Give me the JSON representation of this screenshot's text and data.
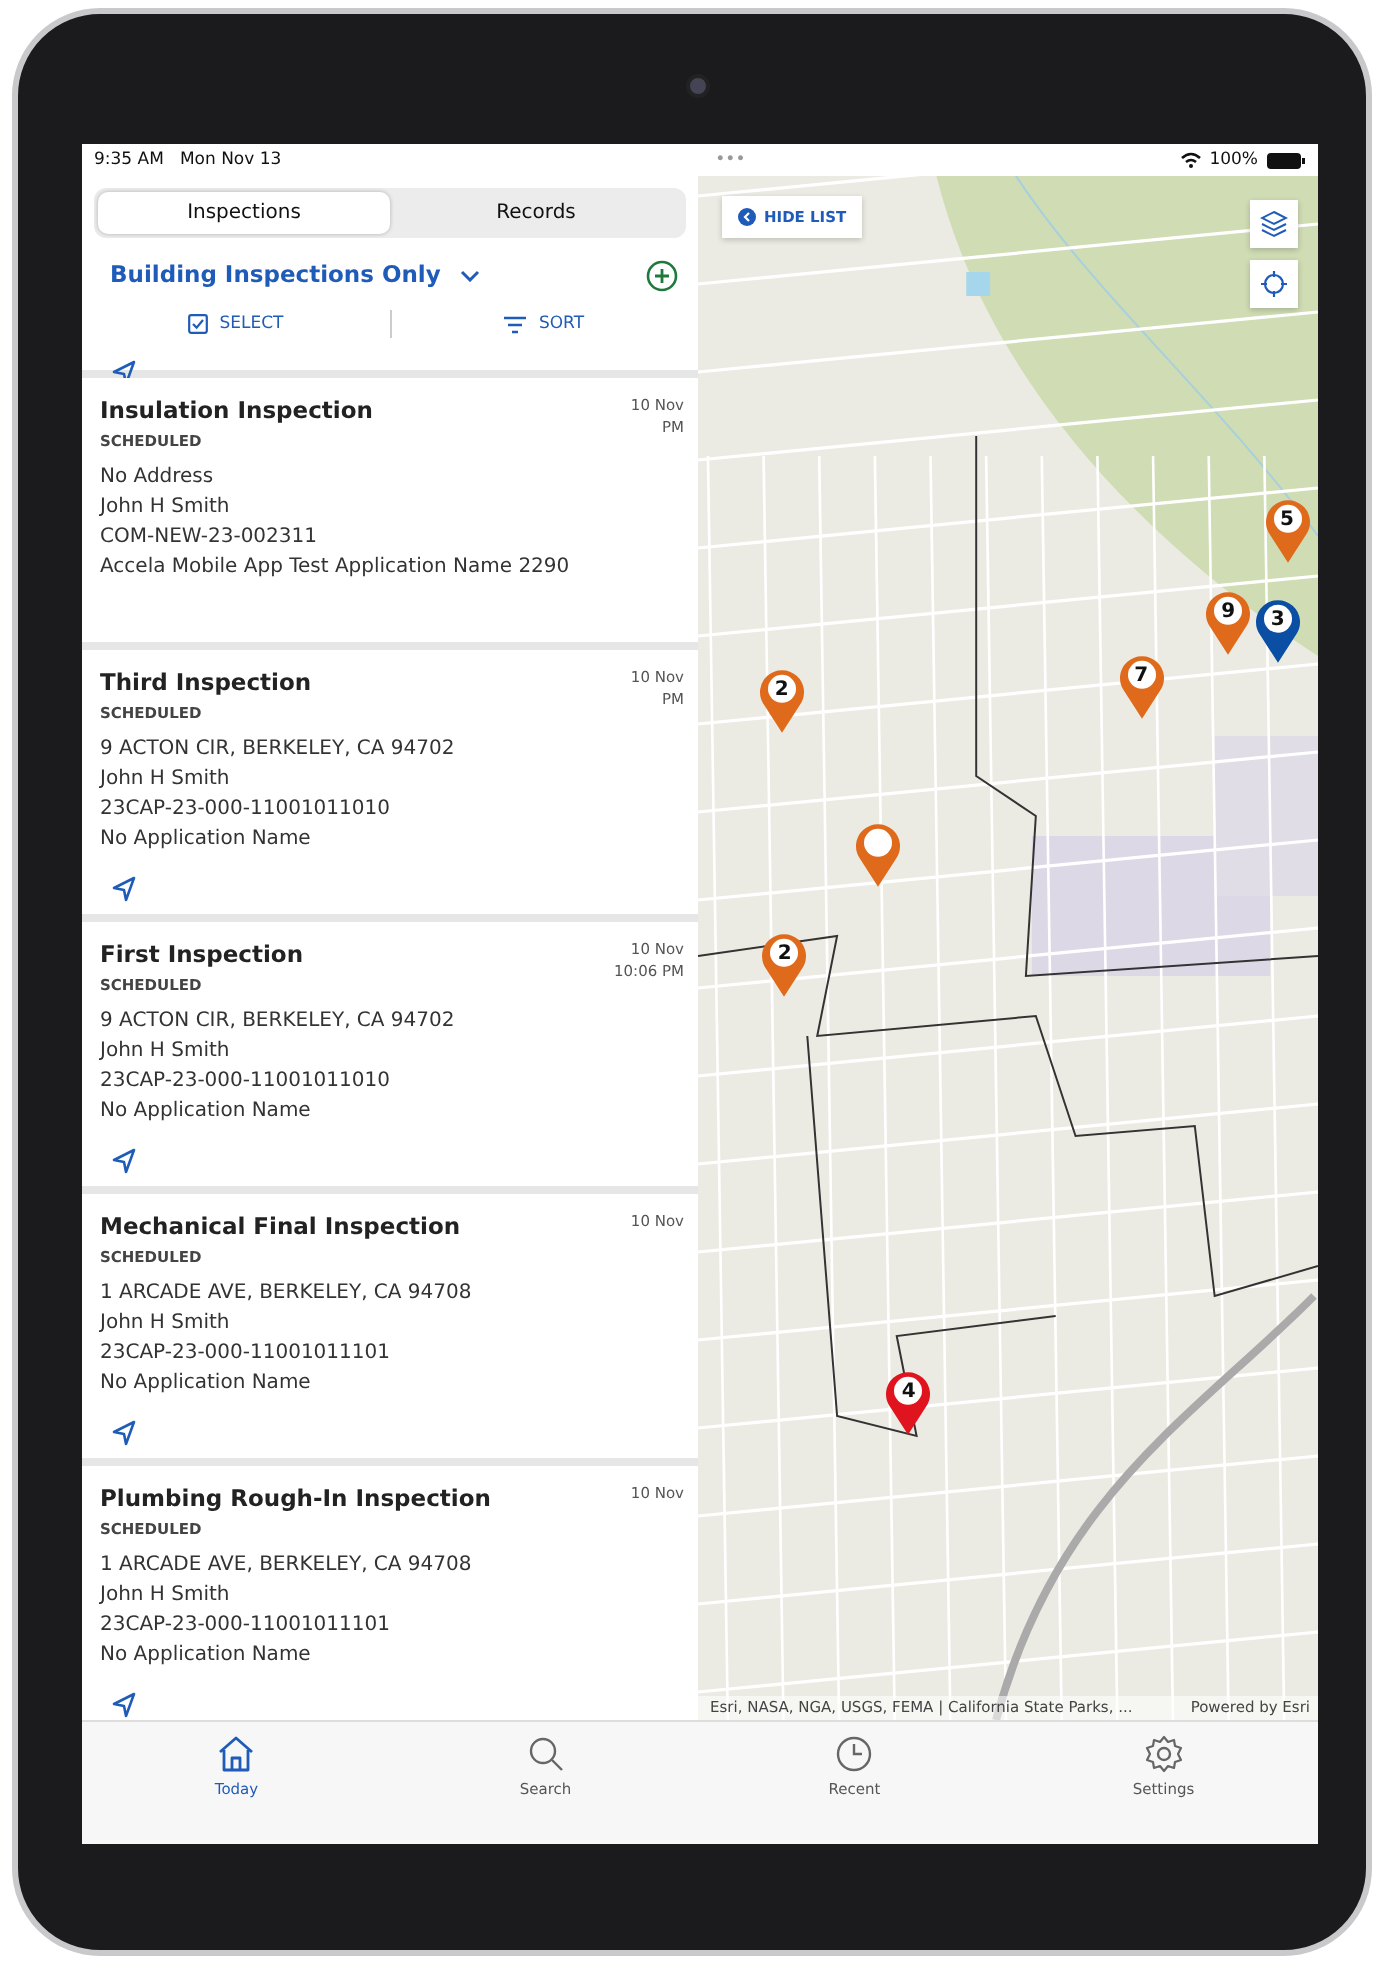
{
  "status_bar": {
    "time": "9:35 AM",
    "date": "Mon Nov 13",
    "dots": "•••",
    "battery": "100%"
  },
  "tabs": [
    {
      "label": "Inspections",
      "selected": true
    },
    {
      "label": "Records",
      "selected": false
    }
  ],
  "filter": {
    "label": "Building Inspections Only"
  },
  "actions": [
    {
      "kind": "select",
      "label": "SELECT"
    },
    {
      "kind": "sort",
      "label": "SORT"
    }
  ],
  "inspections": [
    {
      "navigate": true
    },
    {
      "title": "Insulation Inspection",
      "status": "SCHEDULED",
      "date": "10 Nov",
      "time": "PM",
      "lines": [
        "No Address",
        "John H Smith",
        "COM-NEW-23-002311",
        "Accela Mobile App Test Application Name 2290"
      ],
      "navigate": false
    },
    {
      "title": "Third Inspection",
      "status": "SCHEDULED",
      "date": "10 Nov",
      "time": "PM",
      "lines": [
        "9 ACTON CIR, BERKELEY, CA 94702",
        "John H Smith",
        "23CAP-23-000-11001011010",
        "No Application Name"
      ],
      "navigate": true
    },
    {
      "title": "First Inspection",
      "status": "SCHEDULED",
      "date": "10 Nov",
      "time": "10:06 PM",
      "lines": [
        "9 ACTON CIR, BERKELEY, CA 94702",
        "John H Smith",
        "23CAP-23-000-11001011010",
        "No Application Name"
      ],
      "navigate": true
    },
    {
      "title": "Mechanical Final Inspection",
      "status": "SCHEDULED",
      "date": "10 Nov",
      "lines": [
        "1 ARCADE AVE, BERKELEY, CA 94708",
        "John H Smith",
        "23CAP-23-000-11001011101",
        "No Application Name"
      ],
      "navigate": true
    },
    {
      "title": "Plumbing Rough-In Inspection",
      "status": "SCHEDULED",
      "date": "10 Nov",
      "lines": [
        "1 ARCADE AVE, BERKELEY, CA 94708",
        "John H Smith",
        "23CAP-23-000-11001011101",
        "No Application Name"
      ],
      "navigate": true
    }
  ],
  "map": {
    "hide_list": "HIDE LIST",
    "attribution": "Esri, NASA, NGA, USGS, FEMA | California State Parks, ...",
    "powered_by": "Powered by Esri",
    "pins": [
      {
        "label": "2",
        "color": "#e06a1b"
      },
      {
        "color": "#e06a1b"
      },
      {
        "label": "2",
        "color": "#e06a1b"
      },
      {
        "label": "7",
        "color": "#e06a1b"
      },
      {
        "label": "5",
        "color": "#e06a1b"
      },
      {
        "label": "9",
        "color": "#e06a1b"
      },
      {
        "label": "3",
        "color": "#0a4fa3"
      },
      {
        "label": "4",
        "color": "#e0141e"
      }
    ]
  },
  "tab_bar": [
    {
      "kind": "home",
      "label": "Today",
      "selected": true
    },
    {
      "kind": "search",
      "label": "Search",
      "selected": false
    },
    {
      "kind": "clock",
      "label": "Recent",
      "selected": false
    },
    {
      "kind": "gear",
      "label": "Settings",
      "selected": false
    }
  ]
}
